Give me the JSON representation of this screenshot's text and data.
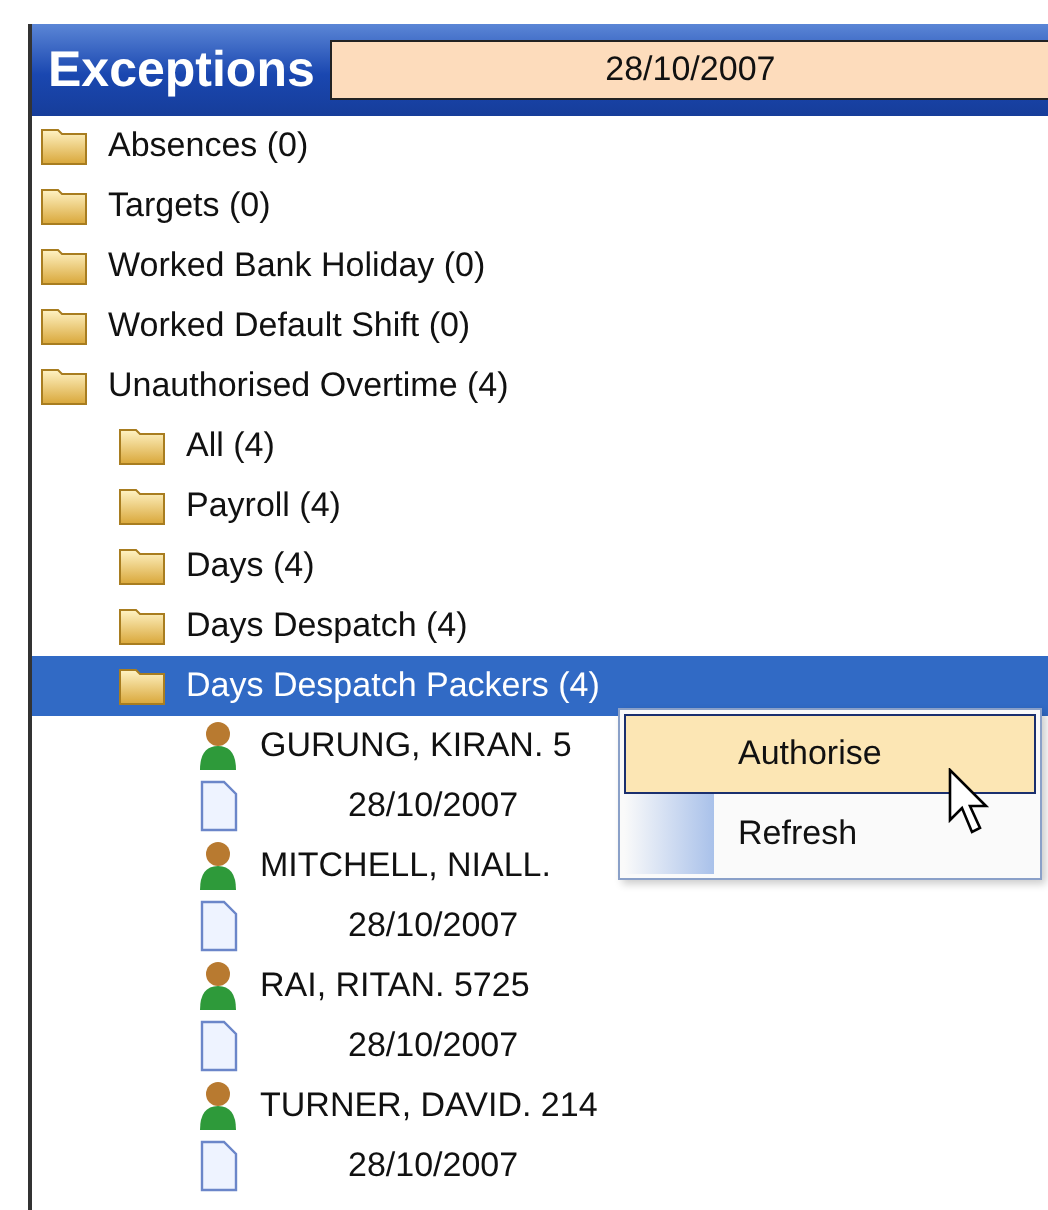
{
  "panel": {
    "title": "Exceptions",
    "date": "28/10/2007"
  },
  "tree": [
    {
      "kind": "folder",
      "label": "Absences (0)",
      "selected": false
    },
    {
      "kind": "folder",
      "label": "Targets (0)",
      "selected": false
    },
    {
      "kind": "folder",
      "label": "Worked Bank Holiday (0)",
      "selected": false
    },
    {
      "kind": "folder",
      "label": "Worked Default Shift (0)",
      "selected": false
    },
    {
      "kind": "folder",
      "label": "Unauthorised Overtime (4)",
      "selected": false,
      "children": [
        {
          "kind": "folder",
          "label": "All (4)",
          "selected": false
        },
        {
          "kind": "folder",
          "label": "Payroll (4)",
          "selected": false
        },
        {
          "kind": "folder",
          "label": "Days (4)",
          "selected": false
        },
        {
          "kind": "folder",
          "label": "Days Despatch (4)",
          "selected": false
        },
        {
          "kind": "folder",
          "label": "Days Despatch Packers (4)",
          "selected": true,
          "children": [
            {
              "kind": "person",
              "label": "GURUNG, KIRAN. 5",
              "selected": false,
              "children": [
                {
                  "kind": "document",
                  "label": "28/10/2007",
                  "selected": false
                }
              ]
            },
            {
              "kind": "person",
              "label": "MITCHELL, NIALL.",
              "selected": false,
              "children": [
                {
                  "kind": "document",
                  "label": "28/10/2007",
                  "selected": false
                }
              ]
            },
            {
              "kind": "person",
              "label": "RAI, RITAN. 5725",
              "selected": false,
              "children": [
                {
                  "kind": "document",
                  "label": "28/10/2007",
                  "selected": false
                }
              ]
            },
            {
              "kind": "person",
              "label": "TURNER, DAVID. 214",
              "selected": false,
              "children": [
                {
                  "kind": "document",
                  "label": "28/10/2007",
                  "selected": false
                }
              ]
            }
          ]
        }
      ]
    }
  ],
  "context_menu": [
    {
      "label": "Authorise",
      "selected": true
    },
    {
      "label": "Refresh",
      "selected": false
    }
  ]
}
